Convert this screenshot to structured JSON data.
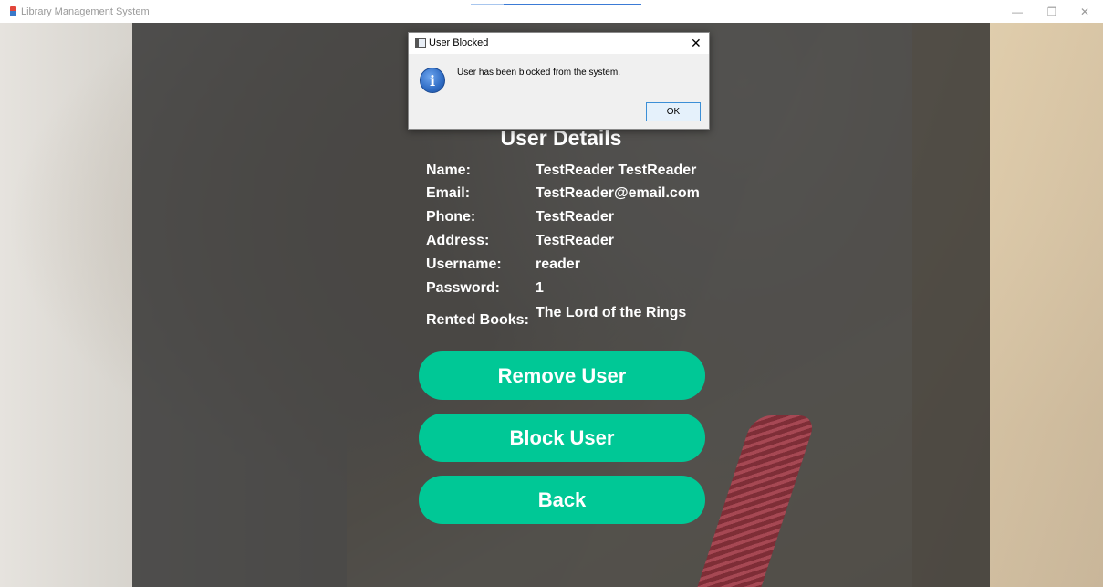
{
  "window": {
    "title": "Library Management System",
    "controls": {
      "minimize": "—",
      "maximize": "❐",
      "close": "✕"
    }
  },
  "details": {
    "heading": "User Details",
    "rows": [
      {
        "label": "Name:",
        "value": "TestReader TestReader"
      },
      {
        "label": "Email:",
        "value": "TestReader@email.com"
      },
      {
        "label": "Phone:",
        "value": "TestReader"
      },
      {
        "label": "Address:",
        "value": "TestReader"
      },
      {
        "label": "Username:",
        "value": "reader"
      },
      {
        "label": "Password:",
        "value": "1"
      },
      {
        "label": "Rented Books:",
        "value": "The Lord of the Rings"
      }
    ]
  },
  "buttons": {
    "remove": "Remove User",
    "block": "Block User",
    "back": "Back"
  },
  "dialog": {
    "title": "User Blocked",
    "close": "✕",
    "icon": "info-icon",
    "icon_glyph": "i",
    "message": "User has been blocked from the system.",
    "ok": "OK"
  },
  "colors": {
    "button": "#00c896",
    "dialog_ok_border": "#3c8fd6",
    "info_icon": "#2f6cc4"
  }
}
